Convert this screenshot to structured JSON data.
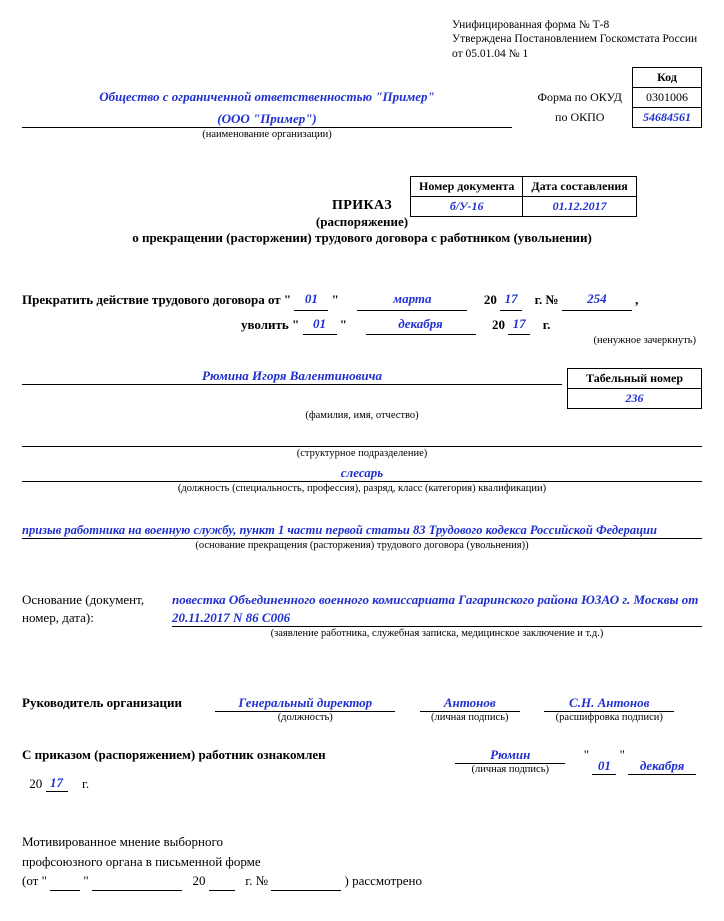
{
  "header": {
    "line1": "Унифицированная форма № Т-8",
    "line2": "Утверждена Постановлением Госкомстата России",
    "line3": "от 05.01.04 № 1"
  },
  "codes": {
    "kod_title": "Код",
    "okud_label": "Форма по ОКУД",
    "okud_value": "0301006",
    "okpo_label": "по ОКПО",
    "okpo_value": "54684561"
  },
  "org": {
    "name_line1": "Общество с ограниченной ответственностью \"Пример\"",
    "name_line2": "(ООО \"Пример\")",
    "caption": "(наименование организации)"
  },
  "doc_number_table": {
    "h1": "Номер документа",
    "h2": "Дата составления",
    "num": "б/У-16",
    "date": "01.12.2017"
  },
  "title": {
    "l1": "ПРИКАЗ",
    "l2": "(распоряжение)",
    "l3": "о прекращении (расторжении) трудового договора с работником (увольнении)"
  },
  "terminate": {
    "prefix": "Прекратить действие трудового договора от \"",
    "day1": "01",
    "mid1": "\"",
    "month1": "марта",
    "yr_prefix": "20",
    "yr1": "17",
    "yr_suffix": "г.  №",
    "num": "254",
    "tail": ",",
    "dismiss_prefix": "уволить \"",
    "day2": "01",
    "mid2": "\"",
    "month2": "декабря",
    "yr2": "17",
    "yr_suffix2": "г.",
    "strike_note": "(ненужное зачеркнуть)"
  },
  "tab_num": {
    "title": "Табельный номер",
    "value": "236"
  },
  "employee": {
    "fio": "Рюмина Игоря Валентиновича",
    "fio_cap": "(фамилия, имя, отчество)",
    "dept": "",
    "dept_cap": "(структурное подразделение)",
    "pos": "слесарь",
    "pos_cap": "(должность (специальность, профессия), разряд, класс (категория) квалификации)"
  },
  "reason": {
    "text": "призыв работника на военную службу, пункт 1 части первой статьи 83 Трудового кодекса Российской Федерации",
    "cap": "(основание прекращения (расторжения) трудового договора (увольнения))"
  },
  "basis": {
    "label": "Основание (документ, номер, дата):",
    "text": "повестка Объединенного военного комиссариата Гагаринского района ЮЗАО г. Москвы от 20.11.2017 N 86 С006",
    "cap": "(заявление работника, служебная записка, медицинское заключение и т.д.)"
  },
  "manager": {
    "label": "Руководитель организации",
    "position": "Генеральный директор",
    "pos_cap": "(должность)",
    "sign": "Антонов",
    "sign_cap": "(личная подпись)",
    "decode": "С.Н. Антонов",
    "decode_cap": "(расшифровка подписи)"
  },
  "ack": {
    "label": "С приказом (распоряжением) работник ознакомлен",
    "sign": "Рюмин",
    "sign_cap": "(личная подпись)",
    "q1": "\"",
    "day": "01",
    "q2": "\"",
    "month": "декабря",
    "yr_prefix": "20",
    "yr": "17",
    "yr_suffix": "г."
  },
  "opinion": {
    "l1": "Мотивированное мнение выборного",
    "l2": "профсоюзного органа в письменной форме",
    "l3a": "(от \"",
    "l3b": "\"",
    "l3c": "20",
    "l3d": "г. №",
    "l3e": ") рассмотрено"
  }
}
